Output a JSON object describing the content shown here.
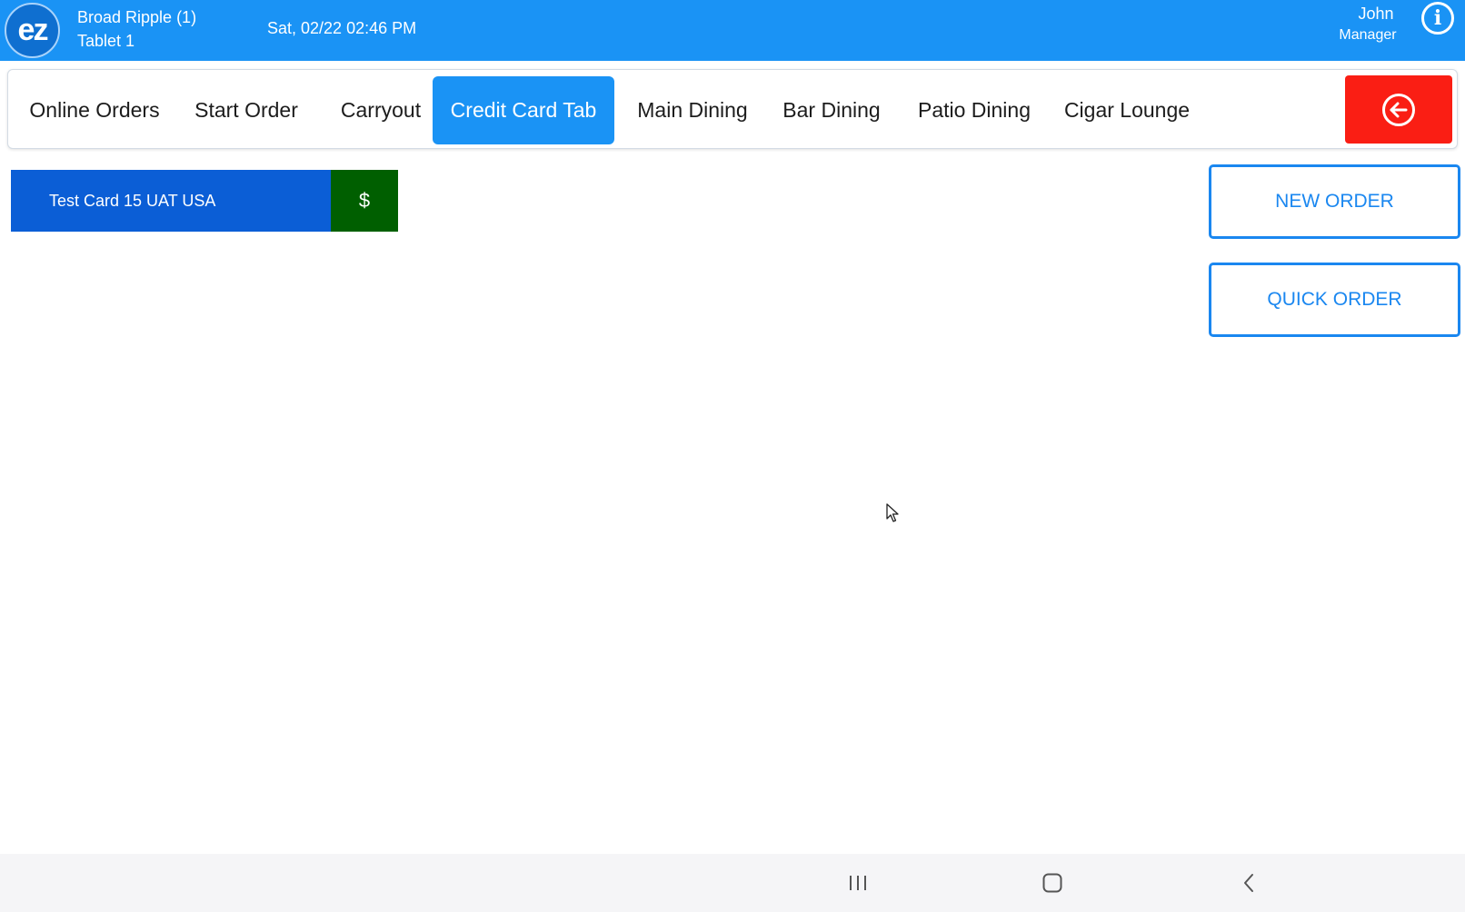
{
  "header": {
    "logo_text": "ez",
    "store": "Broad Ripple (1)",
    "device": "Tablet 1",
    "datetime": "Sat, 02/22 02:46 PM",
    "user_name": "John",
    "user_role": "Manager",
    "info_icon": "info-icon",
    "info_glyph": "i"
  },
  "tabs": [
    {
      "label": "Online Orders",
      "active": false
    },
    {
      "label": "Start Order",
      "active": false
    },
    {
      "label": "Carryout",
      "active": false
    },
    {
      "label": "Credit Card Tab",
      "active": true
    },
    {
      "label": "Main Dining",
      "active": false
    },
    {
      "label": "Bar Dining",
      "active": false
    },
    {
      "label": "Patio Dining",
      "active": false
    },
    {
      "label": "Cigar Lounge",
      "active": false
    }
  ],
  "exit_button": {
    "icon": "arrow-left-circle-icon"
  },
  "open_tabs": [
    {
      "name": "Test Card 15 UAT USA",
      "pay_label": "$"
    }
  ],
  "actions": {
    "new_order": "NEW ORDER",
    "quick_order": "QUICK ORDER"
  },
  "system_nav": {
    "recents_icon": "recent-apps-icon",
    "home_icon": "home-icon",
    "back_icon": "back-icon"
  },
  "colors": {
    "primary": "#1a93f5",
    "exit": "#fa1e14",
    "tab_item": "#0b5ed6",
    "pay": "#005f00",
    "outline": "#1a87f0"
  }
}
